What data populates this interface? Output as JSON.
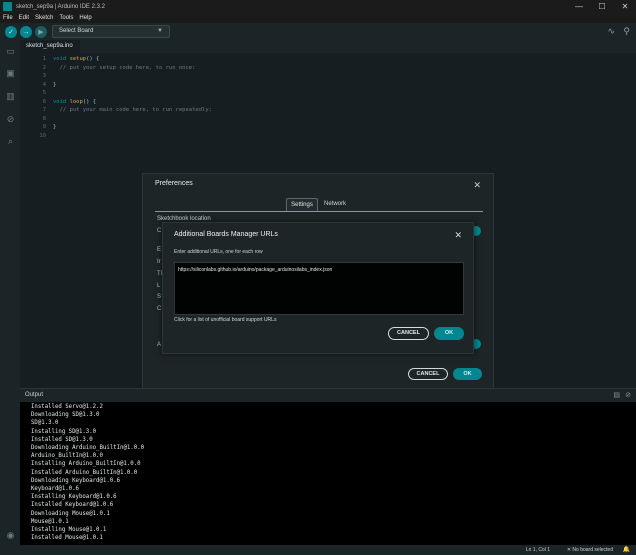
{
  "window": {
    "title": "sketch_sep9a | Arduino IDE 2.3.2",
    "controls": {
      "minimize": "—",
      "maximize": "☐",
      "close": "✕"
    }
  },
  "menu": [
    "File",
    "Edit",
    "Sketch",
    "Tools",
    "Help"
  ],
  "toolbar": {
    "verify_icon": "check-icon",
    "upload_icon": "arrow-right-icon",
    "debug_icon": "debug-icon",
    "board_select": "Select Board",
    "serial_plotter_icon": "plotter-icon",
    "serial_monitor_icon": "monitor-icon"
  },
  "activity_icons": [
    "folder-icon",
    "boards-manager-icon",
    "library-icon",
    "debug-icon",
    "search-icon",
    "account-icon"
  ],
  "editor": {
    "tab": "sketch_sep9a.ino",
    "lines": [
      {
        "n": "1",
        "parts": [
          [
            "kw",
            "void "
          ],
          [
            "fn",
            "setup"
          ],
          [
            "",
            "() {"
          ]
        ]
      },
      {
        "n": "2",
        "parts": [
          [
            "comment",
            "  // put your setup code here, to run once:"
          ]
        ]
      },
      {
        "n": "3",
        "parts": []
      },
      {
        "n": "4",
        "parts": [
          [
            "",
            "}"
          ]
        ]
      },
      {
        "n": "5",
        "parts": []
      },
      {
        "n": "6",
        "parts": [
          [
            "kw",
            "void "
          ],
          [
            "fn",
            "loop"
          ],
          [
            "",
            "() {"
          ]
        ]
      },
      {
        "n": "7",
        "parts": [
          [
            "comment",
            "  // put your main code here, to run repeatedly:"
          ]
        ]
      },
      {
        "n": "8",
        "parts": []
      },
      {
        "n": "9",
        "parts": [
          [
            "",
            "}"
          ]
        ]
      },
      {
        "n": "10",
        "parts": []
      }
    ]
  },
  "preferences": {
    "title": "Preferences",
    "tabs": [
      "Settings",
      "Network"
    ],
    "sketchbook_label": "Sketchbook location",
    "partial_letters": [
      "C",
      "E",
      "Ir",
      "Tl",
      "L",
      "S",
      "C",
      "A"
    ],
    "cancel": "CANCEL",
    "ok": "OK"
  },
  "boards_urls_dialog": {
    "title": "Additional Boards Manager URLs",
    "hint": "Enter additional URLs, one for each row",
    "value": "https://siliconlabs.github.io/arduino/package_arduinosilabs_index.json",
    "link": "Click for a list of unofficial board support URLs",
    "cancel": "CANCEL",
    "ok": "OK"
  },
  "output": {
    "title": "Output",
    "lines": [
      "Installed Servo@1.2.2",
      "Downloading SD@1.3.0",
      "SD@1.3.0",
      "Installing SD@1.3.0",
      "Installed SD@1.3.0",
      "Downloading Arduino_BuiltIn@1.0.0",
      "Arduino_BuiltIn@1.0.0",
      "Installing Arduino_BuiltIn@1.0.0",
      "Installed Arduino_BuiltIn@1.0.0",
      "Downloading Keyboard@1.0.6",
      "Keyboard@1.0.6",
      "Installing Keyboard@1.0.6",
      "Installed Keyboard@1.0.6",
      "Downloading Mouse@1.0.1",
      "Mouse@1.0.1",
      "Installing Mouse@1.0.1",
      "Installed Mouse@1.0.1"
    ]
  },
  "status": {
    "position": "Ln 1, Col 1",
    "board": "✕ No board selected",
    "bell": "🔔"
  }
}
